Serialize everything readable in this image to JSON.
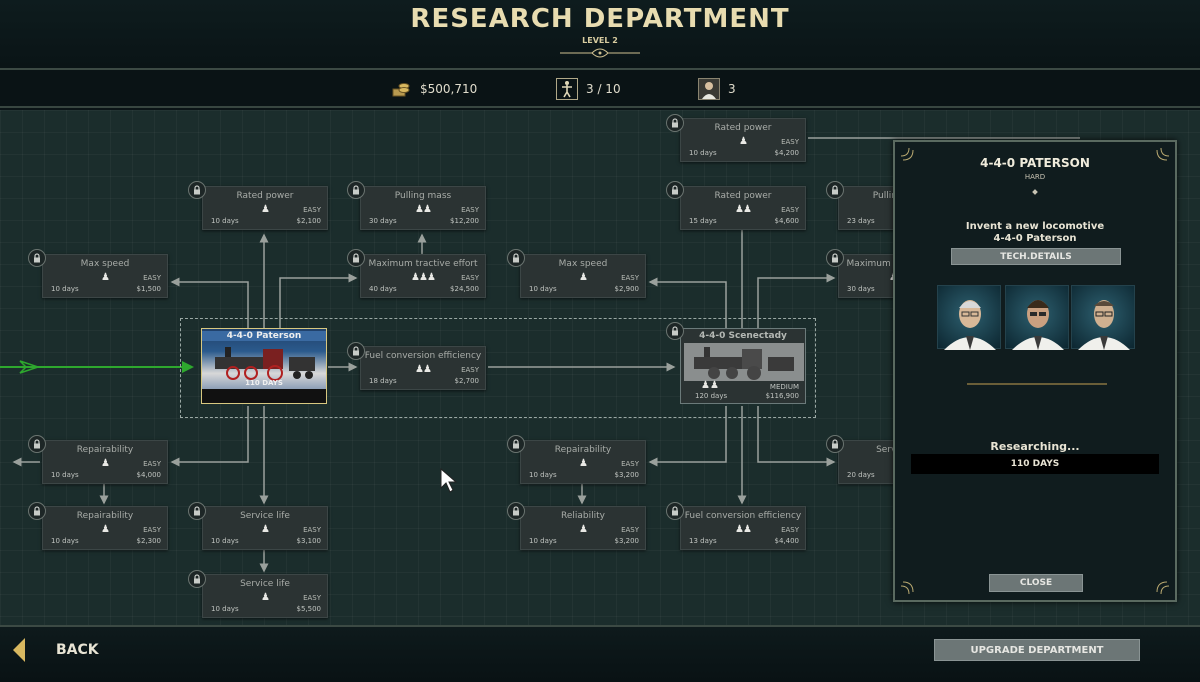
{
  "header": {
    "title": "RESEARCH DEPARTMENT",
    "level": "LEVEL 2"
  },
  "stats": {
    "money": "$500,710",
    "workers": "3 / 10",
    "scientists": "3"
  },
  "nodes": [
    {
      "title": "Rated power",
      "people": "♟",
      "difficulty": "EASY",
      "days": "10 days",
      "cost": "$4,200"
    },
    {
      "title": "Rated power",
      "people": "♟",
      "difficulty": "EASY",
      "days": "10 days",
      "cost": "$2,100"
    },
    {
      "title": "Pulling mass",
      "people": "♟♟",
      "difficulty": "EASY",
      "days": "30 days",
      "cost": "$12,200"
    },
    {
      "title": "Rated power",
      "people": "♟♟",
      "difficulty": "EASY",
      "days": "15 days",
      "cost": "$4,600"
    },
    {
      "title": "Pulling mass",
      "people": "♟♟",
      "difficulty": "",
      "days": "23 days",
      "cost": ""
    },
    {
      "title": "Max speed",
      "people": "♟",
      "difficulty": "EASY",
      "days": "10 days",
      "cost": "$1,500"
    },
    {
      "title": "Maximum tractive effort",
      "people": "♟♟♟",
      "difficulty": "EASY",
      "days": "40 days",
      "cost": "$24,500"
    },
    {
      "title": "Max speed",
      "people": "♟",
      "difficulty": "EASY",
      "days": "10 days",
      "cost": "$2,900"
    },
    {
      "title": "Maximum tractive effort",
      "people": "♟♟♟",
      "difficulty": "",
      "days": "30 days",
      "cost": ""
    },
    {
      "title": "Fuel conversion efficiency",
      "people": "♟♟",
      "difficulty": "EASY",
      "days": "18 days",
      "cost": "$2,700"
    },
    {
      "title": "Repairability",
      "people": "♟",
      "difficulty": "EASY",
      "days": "10 days",
      "cost": "$4,000"
    },
    {
      "title": "Repairability",
      "people": "♟",
      "difficulty": "EASY",
      "days": "10 days",
      "cost": "$3,200"
    },
    {
      "title": "Service life",
      "people": "♟♟",
      "difficulty": "",
      "days": "20 days",
      "cost": ""
    },
    {
      "title": "Repairability",
      "people": "♟",
      "difficulty": "EASY",
      "days": "10 days",
      "cost": "$2,300"
    },
    {
      "title": "Service life",
      "people": "♟",
      "difficulty": "EASY",
      "days": "10 days",
      "cost": "$3,100"
    },
    {
      "title": "Reliability",
      "people": "♟",
      "difficulty": "EASY",
      "days": "10 days",
      "cost": "$3,200"
    },
    {
      "title": "Fuel conversion efficiency",
      "people": "♟♟",
      "difficulty": "EASY",
      "days": "13 days",
      "cost": "$4,400"
    },
    {
      "title": "Service life",
      "people": "♟",
      "difficulty": "EASY",
      "days": "10 days",
      "cost": "$5,500"
    }
  ],
  "locos": {
    "active": {
      "title": "4-4-0 Paterson",
      "days": "110 DAYS"
    },
    "locked": {
      "title": "4-4-0 Scenectady",
      "people": "♟♟",
      "difficulty": "MEDIUM",
      "days": "120 days",
      "cost": "$116,900"
    }
  },
  "panel": {
    "title": "4-4-0 PATERSON",
    "difficulty": "HARD",
    "desc_line1": "Invent a new locomotive",
    "desc_line2": "4-4-0 Paterson",
    "tech_details": "TECH.DETAILS",
    "status": "Researching...",
    "days": "110 DAYS",
    "close": "CLOSE"
  },
  "footer": {
    "back": "BACK",
    "upgrade": "UPGRADE DEPARTMENT"
  },
  "colors": {
    "accent_gold": "#e8dcb0",
    "active_path": "#2ea82e",
    "panel_border": "#5a6a60"
  }
}
